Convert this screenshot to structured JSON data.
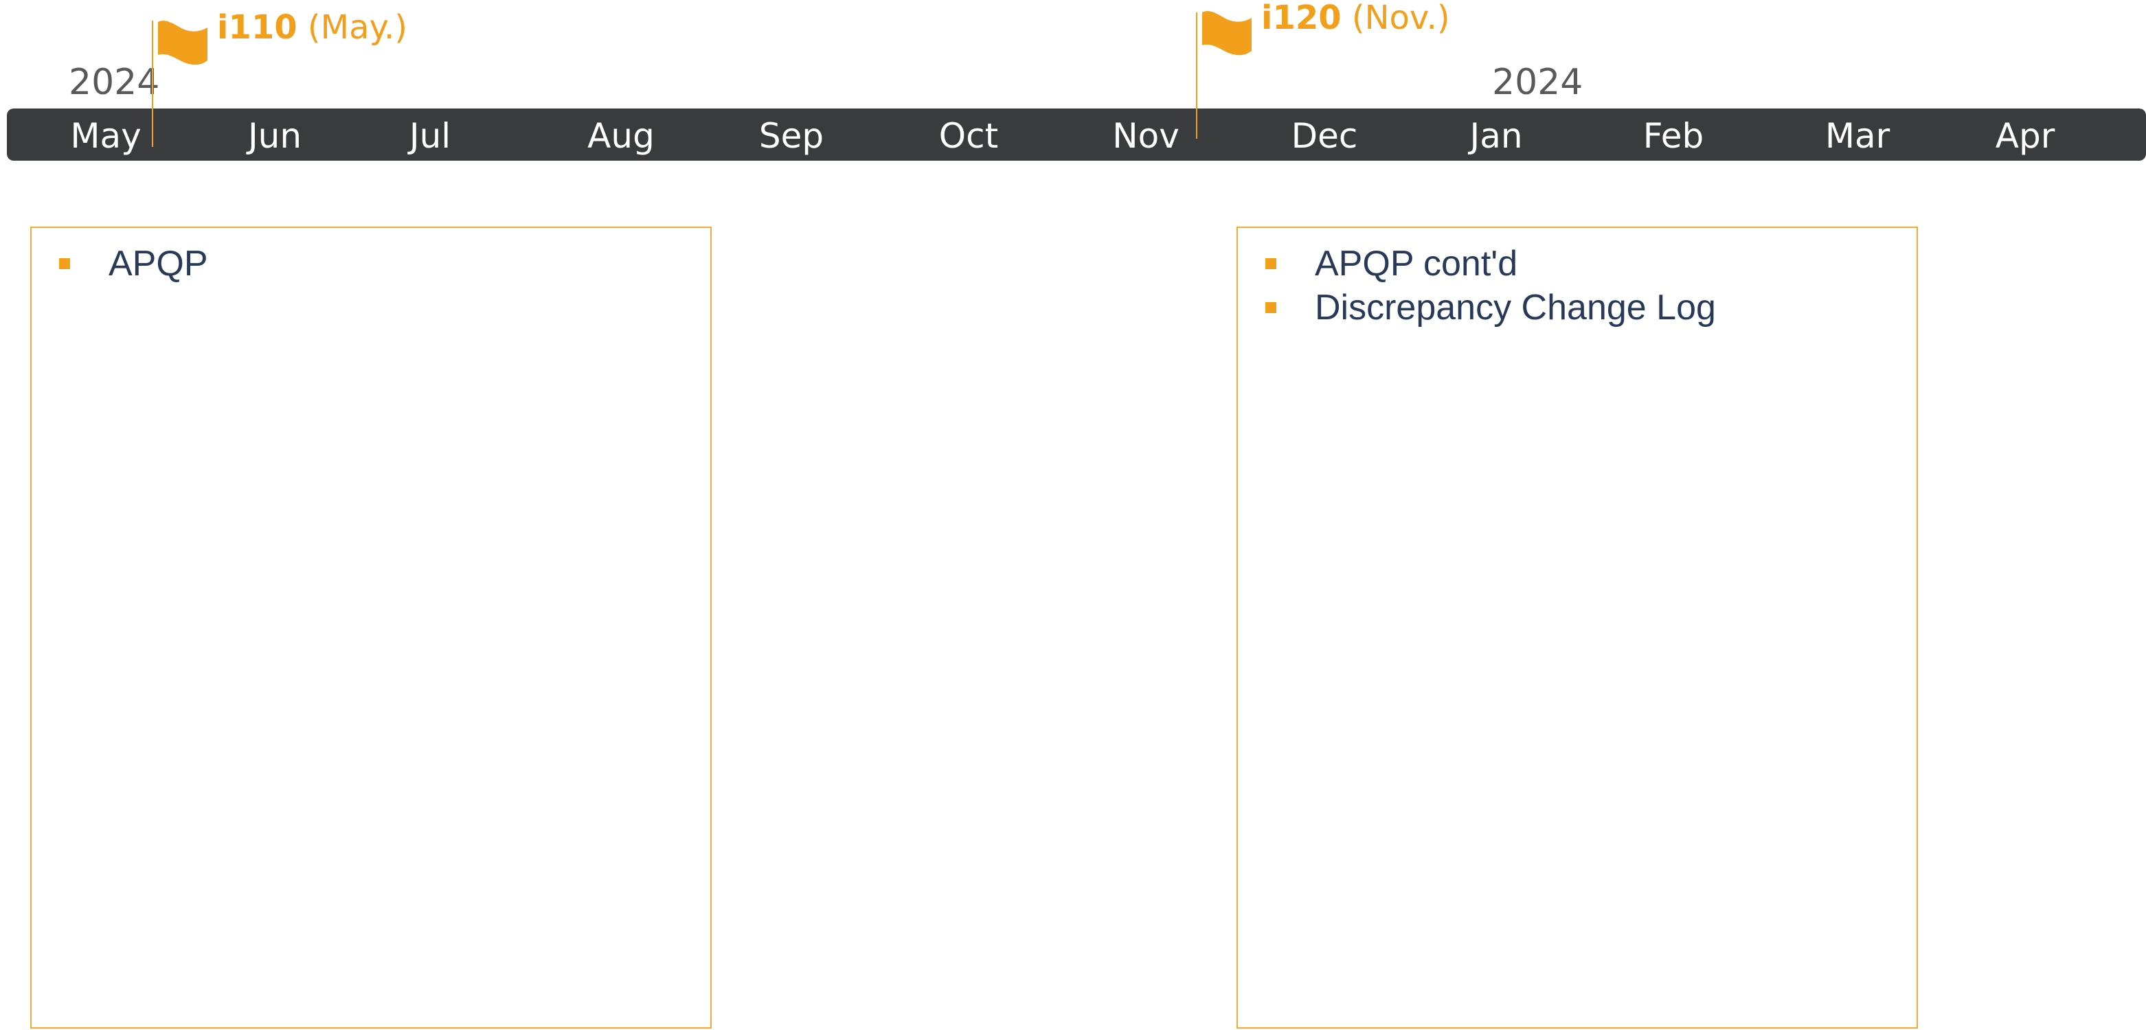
{
  "timeline": {
    "year_labels": [
      "2024",
      "2024"
    ],
    "months": [
      "May",
      "Jun",
      "Jul",
      "Aug",
      "Sep",
      "Oct",
      "Nov",
      "Dec",
      "Jan",
      "Feb",
      "Mar",
      "Apr"
    ]
  },
  "milestones": [
    {
      "name": "i110",
      "when": "(May.)"
    },
    {
      "name": "i120",
      "when": "(Nov.)"
    }
  ],
  "boxes": [
    {
      "items": [
        "APQP"
      ]
    },
    {
      "items": [
        "APQP cont'd",
        "Discrepancy Change Log"
      ]
    }
  ],
  "colors": {
    "accent": "#f29f1c",
    "box_border": "#f4a93a",
    "bar": "#3a3b3d",
    "bar_text": "#ffffff",
    "year_text": "#595959",
    "body_text": "#283a57"
  }
}
